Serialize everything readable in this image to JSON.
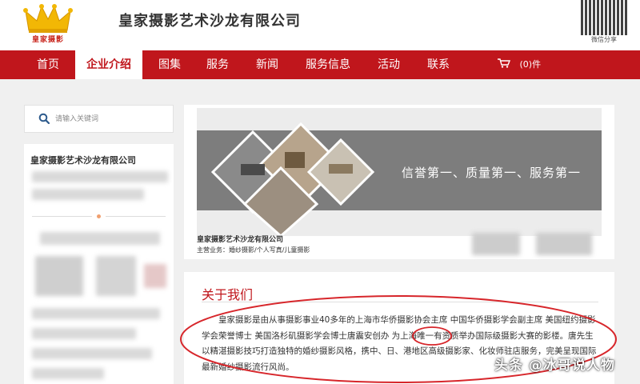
{
  "header": {
    "logo_text": "皇家摄影",
    "company_name": "皇家摄影艺术沙龙有限公司",
    "qr_label": "微信分享"
  },
  "nav": {
    "items": [
      {
        "label": "首页"
      },
      {
        "label": "企业介绍",
        "active": true
      },
      {
        "label": "图集"
      },
      {
        "label": "服务"
      },
      {
        "label": "新闻"
      },
      {
        "label": "服务信息"
      },
      {
        "label": "活动"
      },
      {
        "label": "联系"
      }
    ],
    "cart_label": "(0)件"
  },
  "search": {
    "placeholder": "请输入关键词"
  },
  "sidebar": {
    "company_name": "皇家摄影艺术沙龙有限公司"
  },
  "banner": {
    "slogan": "信誉第一、质量第一、服务第一",
    "company_name": "皇家摄影艺术沙龙有限公司",
    "business_label": "主营业务：",
    "business_value": "婚纱摄影/个人写真/儿童摄影"
  },
  "about": {
    "title": "关于我们",
    "text": "皇家摄影是由从事摄影事业40多年的上海市华侨摄影协会主席 中国华侨摄影学会副主席 美国纽约摄影学会荣誉博士 美国洛杉矶摄影学会博士唐震安创办 为上海唯一有资质举办国际级摄影大赛的影楼。唐先生以精湛摄影技巧打造独特的婚纱摄影风格，携中、日、港地区高级摄影家、化妆师驻店服务，完美呈现国际最新婚纱摄影流行风尚。"
  },
  "watermark": "头条 @冰哥说人物",
  "colors": {
    "brand_red": "#c0161c",
    "annotation_red": "#d7262b"
  }
}
